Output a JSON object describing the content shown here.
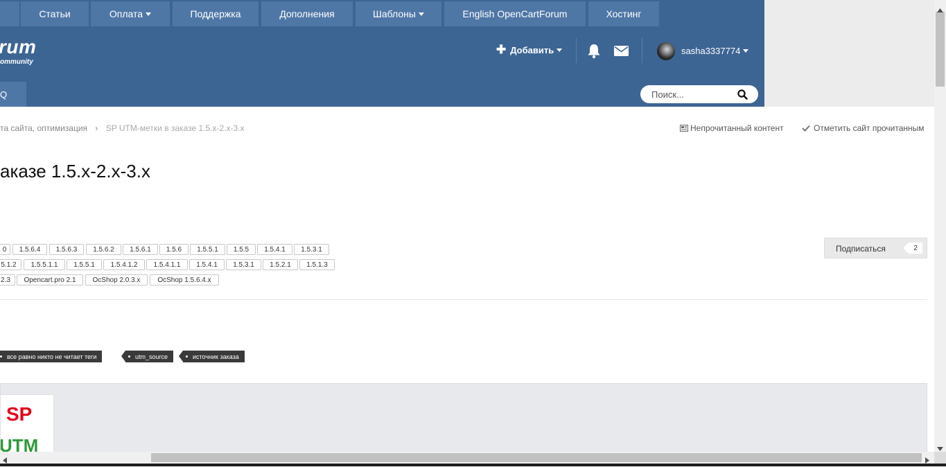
{
  "topnav": [
    {
      "label": "Статьи",
      "caret": false
    },
    {
      "label": "Оплата",
      "caret": true
    },
    {
      "label": "Поддержка",
      "caret": false
    },
    {
      "label": "Дополнения",
      "caret": false
    },
    {
      "label": "Шаблоны",
      "caret": true
    },
    {
      "label": "English OpenCartForum",
      "caret": false
    },
    {
      "label": "Хостинг",
      "caret": false
    }
  ],
  "logo": {
    "main": "rum",
    "sub": "ommunity"
  },
  "user_bar": {
    "add_label": "Добавить",
    "username": "sasha3337774"
  },
  "subnav": {
    "tab_label": "Q"
  },
  "search": {
    "placeholder": "Поиск..."
  },
  "breadcrumb": {
    "parent": "та сайта, оптимизация",
    "current": "SP UTM-метки в заказе 1.5.x-2.x-3.x"
  },
  "actions": {
    "unread": "Непрочитанный контент",
    "mark_read": "Отметить сайт прочитанным"
  },
  "title": "аказе 1.5.x-2.x-3.x",
  "version_tags_row1": [
    "0",
    "1.5.6.4",
    "1.5.6.3",
    "1.5.6.2",
    "1.5.6.1",
    "1.5.6",
    "1.5.5.1",
    "1.5.5",
    "1.5.4.1",
    "1.5.3.1"
  ],
  "version_tags_row2": [
    "5.1.2",
    "1.5.5.1.1",
    "1.5.5.1",
    "1.5.4.1.2",
    "1.5.4.1.1",
    "1.5.4.1",
    "1.5.3.1",
    "1.5.2.1",
    "1.5.1.3"
  ],
  "version_tags_row3": [
    "2.3",
    "Opencart.pro 2.1",
    "OcShop 2.0.3.x",
    "OcShop 1.5.6.4.x"
  ],
  "subscribe": {
    "label": "Подписаться",
    "count": "2"
  },
  "prefix_tags": [
    "все равно никто не читает теги",
    "utm_source",
    "источник заказа"
  ],
  "product_image": {
    "line1": "SP",
    "line2": "UTM"
  },
  "colors": {
    "header": "#3d6594",
    "nav_tab": "#4f77a6",
    "sp_red": "#e4001b",
    "utm_green": "#2e9a3a",
    "tag_dark": "#3a3a3a"
  }
}
